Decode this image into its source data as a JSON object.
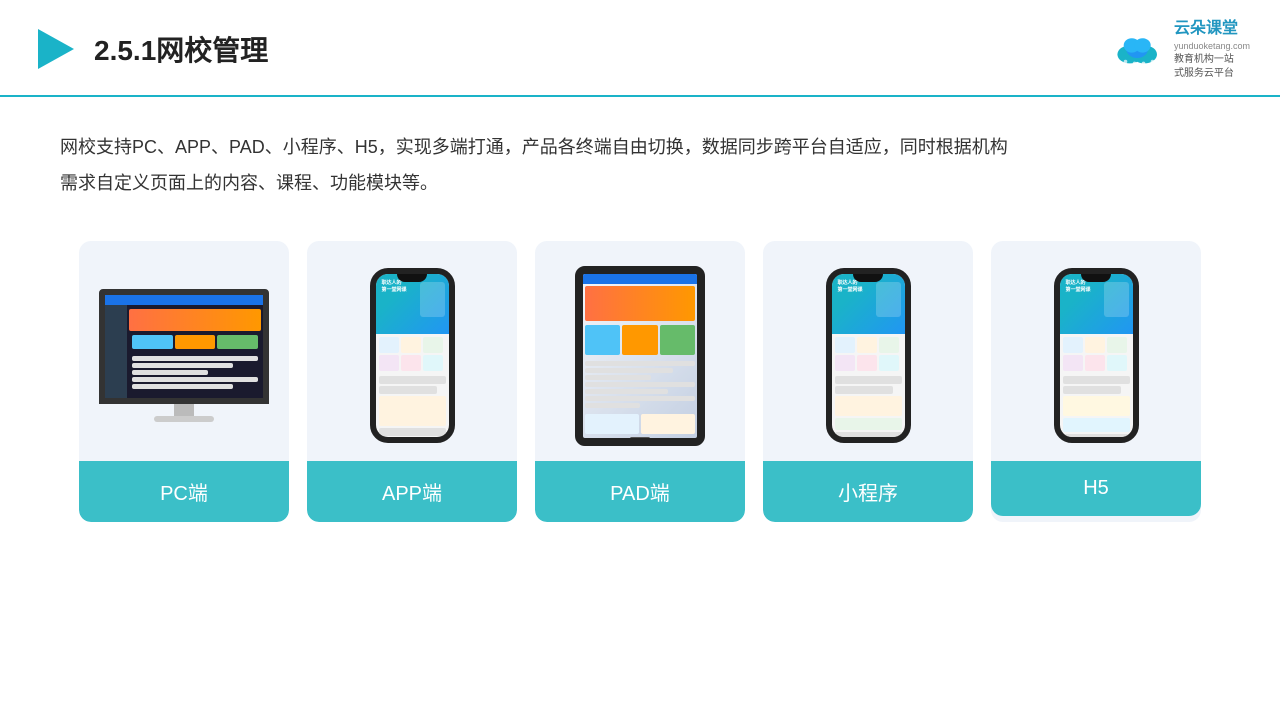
{
  "header": {
    "title": "2.5.1网校管理",
    "logo_name": "云朵课堂",
    "logo_sub": "yunduoketang.com",
    "logo_tagline": "教育机构一站\n式服务云平台"
  },
  "description": {
    "text": "网校支持PC、APP、PAD、小程序、H5，实现多端打通，产品各终端自由切换，数据同步跨平台自适应，同时根据机构\n需求自定义页面上的内容、课程、功能模块等。"
  },
  "cards": [
    {
      "id": "pc",
      "label": "PC端",
      "type": "pc"
    },
    {
      "id": "app",
      "label": "APP端",
      "type": "phone"
    },
    {
      "id": "pad",
      "label": "PAD端",
      "type": "tablet"
    },
    {
      "id": "miniapp",
      "label": "小程序",
      "type": "phone"
    },
    {
      "id": "h5",
      "label": "H5",
      "type": "phone"
    }
  ],
  "colors": {
    "accent": "#3bbfc8",
    "header_border": "#1ab3c8",
    "bg_card": "#eef2f8"
  }
}
